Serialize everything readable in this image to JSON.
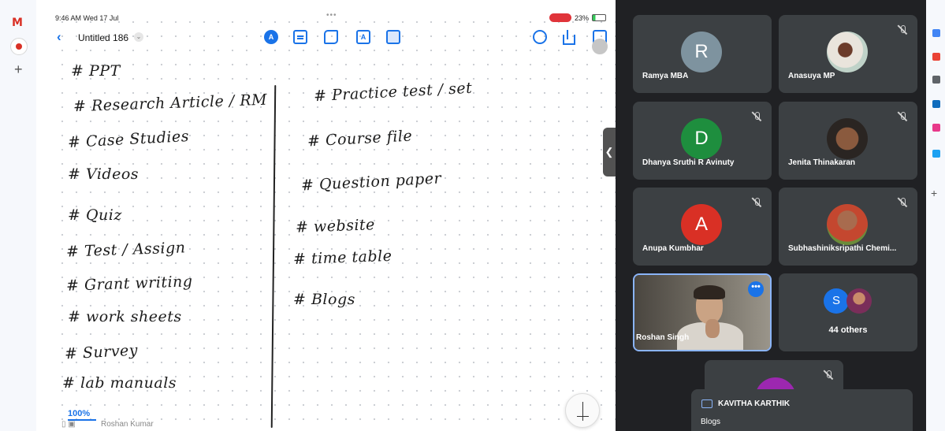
{
  "ipad": {
    "status": {
      "time": "9:46 AM  Wed 17 Jul",
      "dots": "•••",
      "battery": "23%"
    },
    "doc_title": "Untitled 186",
    "pen_badge": "A",
    "text_tool": "A",
    "zoom": "100%",
    "footer_name": "Roshan Kumar",
    "left_column": [
      "# PPT",
      "# Research Article / RM",
      "# Case Studies",
      "# Videos",
      "# Quiz",
      "# Test / Assign",
      "# Grant writing",
      "# work sheets",
      "# Survey",
      "# lab manuals"
    ],
    "right_column": [
      "# Practice test / set",
      "# Course file",
      "# Question paper",
      "# website",
      "# time table",
      "# Blogs"
    ]
  },
  "collapse_glyph": "❮",
  "participants": [
    {
      "name": "Ramya MBA",
      "initial": "R",
      "avatar_color": "#7e939f",
      "muted": false
    },
    {
      "name": "Anasuya MP",
      "initial": "",
      "avatar_color": "#e9e4dc",
      "muted": true
    },
    {
      "name": "Dhanya Sruthi R Avinuty",
      "initial": "D",
      "avatar_color": "#1e8e3e",
      "muted": true
    },
    {
      "name": "Jenita Thinakaran",
      "initial": "",
      "avatar_color": "#8a5a3e",
      "muted": true
    },
    {
      "name": "Anupa Kumbhar",
      "initial": "A",
      "avatar_color": "#d93025",
      "muted": true
    },
    {
      "name": "Subhashiniksripathi Chemi...",
      "initial": "",
      "avatar_color": "#c4472f",
      "muted": true
    }
  ],
  "self": {
    "name": "Roshan Singh",
    "menu": "•••"
  },
  "others": {
    "initial": "S",
    "label": "44 others"
  },
  "chat": {
    "sender": "KAVITHA KARTHIK",
    "message": "Blogs"
  },
  "left_rail": {
    "gmail": "M",
    "plus": "+"
  },
  "right_rail": {
    "plus": "+"
  },
  "colors": {
    "accent": "#1a73e8",
    "tile": "#3c4043",
    "meet_bg": "#202124"
  }
}
